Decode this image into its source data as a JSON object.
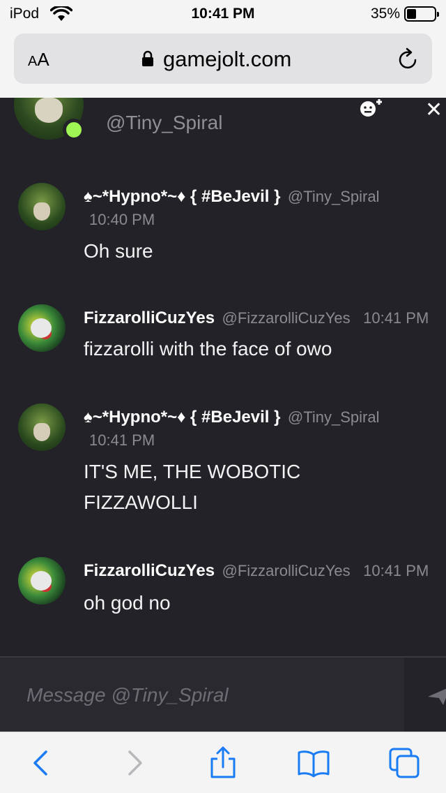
{
  "status_bar": {
    "carrier": "iPod",
    "time": "10:41 PM",
    "battery": "35%",
    "battery_level": 0.35
  },
  "url_bar": {
    "text_size_label_small": "A",
    "text_size_label_large": "A",
    "domain": "gamejolt.com"
  },
  "chat_header": {
    "username": "@Tiny_Spiral",
    "online": true
  },
  "messages": [
    {
      "name": "♠~*Hypno*~♦ { #BeJevil }",
      "handle": "@Tiny_Spiral",
      "time": "10:40 PM",
      "text": "Oh sure"
    },
    {
      "name": "FizzarolliCuzYes",
      "handle": "@FizzarolliCuzYes",
      "time": "10:41 PM",
      "text": "fizzarolli with the face of owo"
    },
    {
      "name": "♠~*Hypno*~♦ { #BeJevil }",
      "handle": "@Tiny_Spiral",
      "time": "10:41 PM",
      "text": "IT'S ME, THE WOBOTIC FIZZAWOLLI"
    },
    {
      "name": "FizzarolliCuzYes",
      "handle": "@FizzarolliCuzYes",
      "time": "10:41 PM",
      "text": "oh god no"
    }
  ],
  "composer": {
    "placeholder": "Message @Tiny_Spiral"
  },
  "toolbar": {
    "icons": [
      "back-icon",
      "forward-icon",
      "share-icon",
      "bookmarks-icon",
      "tabs-icon"
    ]
  },
  "colors": {
    "background": "#232228",
    "accent": "#9ef553",
    "ios_blue": "#1a7cf5"
  }
}
